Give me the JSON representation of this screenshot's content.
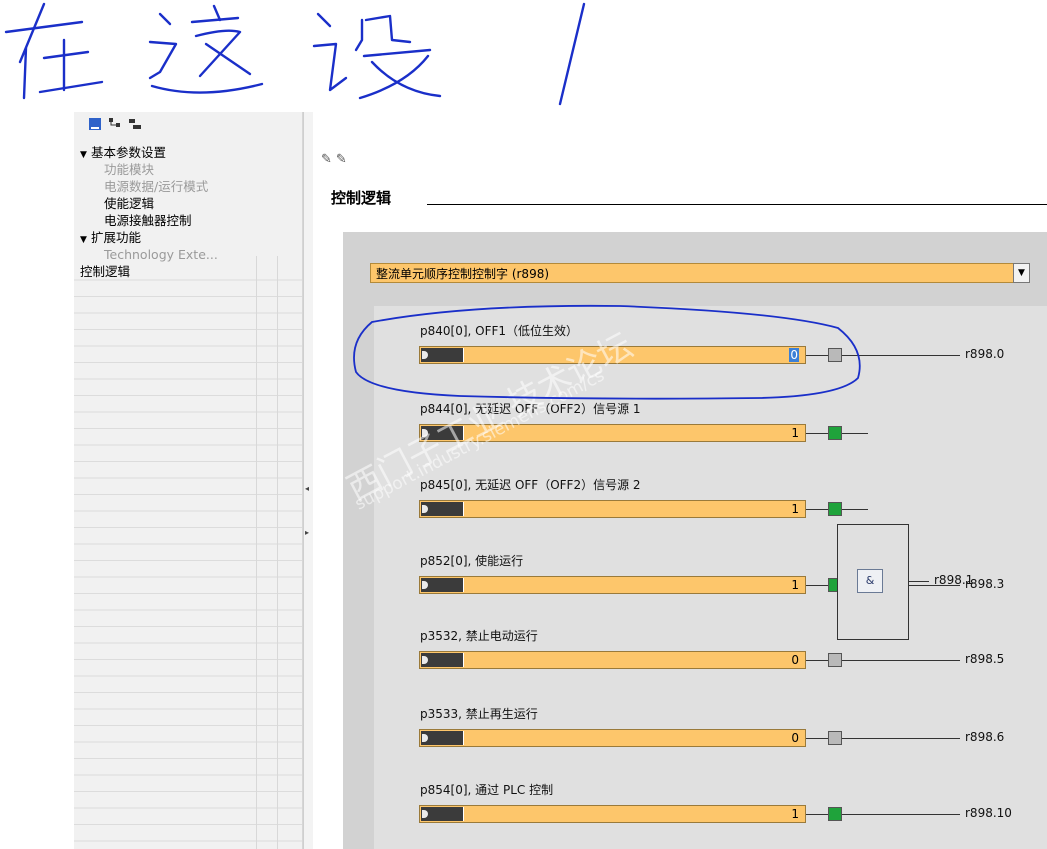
{
  "handwriting": {
    "text": "在这设 /"
  },
  "tree": {
    "items": [
      {
        "label": "基本参数设置",
        "level": 0,
        "expanded": true,
        "state": "normal"
      },
      {
        "label": "功能模块",
        "level": 1,
        "state": "grey"
      },
      {
        "label": "电源数据/运行模式",
        "level": 1,
        "state": "grey"
      },
      {
        "label": "使能逻辑",
        "level": 1,
        "state": "normal"
      },
      {
        "label": "电源接触器控制",
        "level": 1,
        "state": "normal"
      },
      {
        "label": "扩展功能",
        "level": 0,
        "expanded": true,
        "state": "normal"
      },
      {
        "label": "Technology Exte...",
        "level": 1,
        "state": "grey"
      },
      {
        "label": "控制逻辑",
        "level": 0,
        "state": "selected"
      }
    ]
  },
  "main": {
    "section_title": "控制逻辑",
    "dropdown_value": "整流单元顺序控制控制字 (r898)",
    "watermark": {
      "line1": "西门子工业 技术论坛",
      "line2": "support.industry.siemens.com/cs"
    },
    "and_gate_label": "&",
    "params": [
      {
        "label": "p840[0], OFF1（低位生效）",
        "value": "0",
        "state": "off",
        "output": "r898.0",
        "highlighted": true
      },
      {
        "label": "p844[0], 无延迟 OFF（OFF2）信号源 1",
        "value": "1",
        "state": "on",
        "output": ""
      },
      {
        "label": "p845[0], 无延迟 OFF（OFF2）信号源 2",
        "value": "1",
        "state": "on",
        "output": ""
      },
      {
        "label": "p852[0], 使能运行",
        "value": "1",
        "state": "on",
        "output": "r898.3"
      },
      {
        "label": "p3532, 禁止电动运行",
        "value": "0",
        "state": "off",
        "output": "r898.5"
      },
      {
        "label": "p3533, 禁止再生运行",
        "value": "0",
        "state": "off",
        "output": "r898.6"
      },
      {
        "label": "p854[0], 通过 PLC 控制",
        "value": "1",
        "state": "on",
        "output": "r898.10"
      }
    ],
    "and_output": "r898.1"
  },
  "colors": {
    "field": "#fdc66b",
    "status_on": "#1fa33b",
    "status_off": "#b9b9b9",
    "annotation": "#1a2fc9"
  }
}
